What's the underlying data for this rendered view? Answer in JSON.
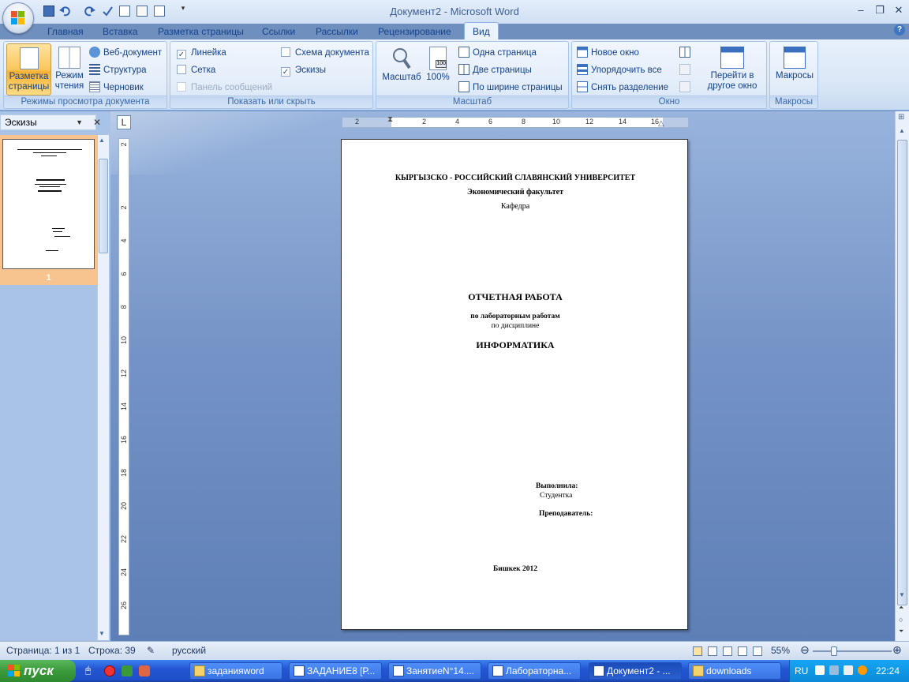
{
  "window": {
    "title": "Документ2 - Microsoft Word"
  },
  "qat_icons": [
    "save-icon",
    "undo-icon",
    "redo-icon",
    "spelling-icon",
    "print-preview-icon",
    "copy-icon",
    "new-document-icon",
    "customize-icon"
  ],
  "tabs": [
    "Главная",
    "Вставка",
    "Разметка страницы",
    "Ссылки",
    "Рассылки",
    "Рецензирование",
    "Вид"
  ],
  "active_tab": "Вид",
  "ribbon": {
    "views": {
      "label": "Режимы просмотра документа",
      "print_layout": "Разметка\nстраницы",
      "reading": "Режим\nчтения",
      "web": "Веб-документ",
      "outline": "Структура",
      "draft": "Черновик"
    },
    "show": {
      "label": "Показать или скрыть",
      "ruler": "Линейка",
      "gridlines": "Сетка",
      "message_bar": "Панель сообщений",
      "doc_map": "Схема документа",
      "thumbnails": "Эскизы"
    },
    "zoom": {
      "label": "Масштаб",
      "zoom": "Масштаб",
      "hundred": "100%",
      "one_page": "Одна страница",
      "two_pages": "Две страницы",
      "page_width": "По ширине страницы"
    },
    "window": {
      "label": "Окно",
      "new_window": "Новое окно",
      "arrange_all": "Упорядочить все",
      "remove_split": "Снять разделение",
      "switch": "Перейти в\nдругое окно"
    },
    "macros": {
      "label": "Макросы",
      "macros": "Макросы"
    }
  },
  "thumbnails": {
    "header": "Эскизы",
    "page_number": "1"
  },
  "ruler_h": [
    "2",
    "2",
    "4",
    "6",
    "8",
    "10",
    "12",
    "14",
    "16"
  ],
  "ruler_v": [
    "2",
    "2",
    "4",
    "6",
    "8",
    "10",
    "12",
    "14",
    "16",
    "18",
    "20",
    "22",
    "24",
    "26"
  ],
  "document": {
    "university": "КЫРГЫЗСКО - РОССИЙСКИЙ  СЛАВЯНСКИЙ  УНИВЕРСИТЕТ",
    "faculty": "Экономический  факультет",
    "department": "Кафедра",
    "title": "ОТЧЕТНАЯ  РАБОТА",
    "subtitle1": "по лабораторным работам",
    "subtitle2": "по дисциплине",
    "subject": "ИНФОРМАТИКА",
    "done_by": "Выполнила:",
    "student": "Студентка",
    "teacher": "Преподаватель:",
    "city_year": "Бишкек 2012"
  },
  "status": {
    "page": "Страница: 1 из 1",
    "line": "Строка: 39",
    "language": "русский",
    "zoom": "55%"
  },
  "taskbar": {
    "start": "пуск",
    "tasks": [
      "заданияword",
      "ЗАДАНИЕ8 [Р...",
      "ЗанятиеN°14....",
      "Лабораторна...",
      "Документ2 - ...",
      "downloads"
    ],
    "active_task": 4,
    "lang": "RU",
    "clock": "22:24"
  },
  "colors": {
    "ribbon_bg": "#dbe7f7",
    "accent_text": "#15428b",
    "active_button": "#fbc65b",
    "taskbar": "#2456d3",
    "start_green": "#3a9a3a"
  }
}
